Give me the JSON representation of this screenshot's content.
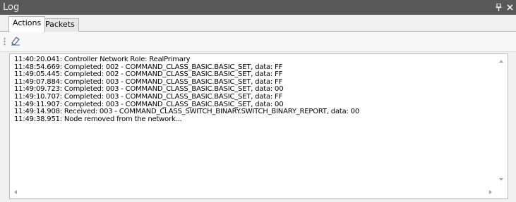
{
  "window": {
    "title": "Log",
    "pin_glyph": "Ѧ",
    "close_glyph": "✕"
  },
  "tabs": [
    {
      "label": "Actions",
      "active": true
    },
    {
      "label": "Packets",
      "active": false
    }
  ],
  "toolbar": {
    "clear_icon": "eraser-icon"
  },
  "log": {
    "lines": [
      "11:40:20.041: Controller Network Role: RealPrimary",
      "11:48:54.669: Completed: 002 - COMMAND_CLASS_BASIC.BASIC_SET, data: FF",
      "11:49:05.445: Completed: 002 - COMMAND_CLASS_BASIC.BASIC_SET, data: FF",
      "11:49:07.884: Completed: 003 - COMMAND_CLASS_BASIC.BASIC_SET, data: FF",
      "11:49:09.723: Completed: 003 - COMMAND_CLASS_BASIC.BASIC_SET, data: 00",
      "11:49:10.707: Completed: 003 - COMMAND_CLASS_BASIC.BASIC_SET, data: FF",
      "11:49:11.907: Completed: 003 - COMMAND_CLASS_BASIC.BASIC_SET, data: 00",
      "11:49:14.908: Received: 003 - COMMAND_CLASS_SWITCH_BINARY.SWITCH_BINARY_REPORT, data: 00",
      "11:49:38.951: Node removed from the network..."
    ]
  },
  "colors": {
    "titlebar": "#595959",
    "panel_bg": "#f0f0f0",
    "log_bg": "#ffffff"
  }
}
